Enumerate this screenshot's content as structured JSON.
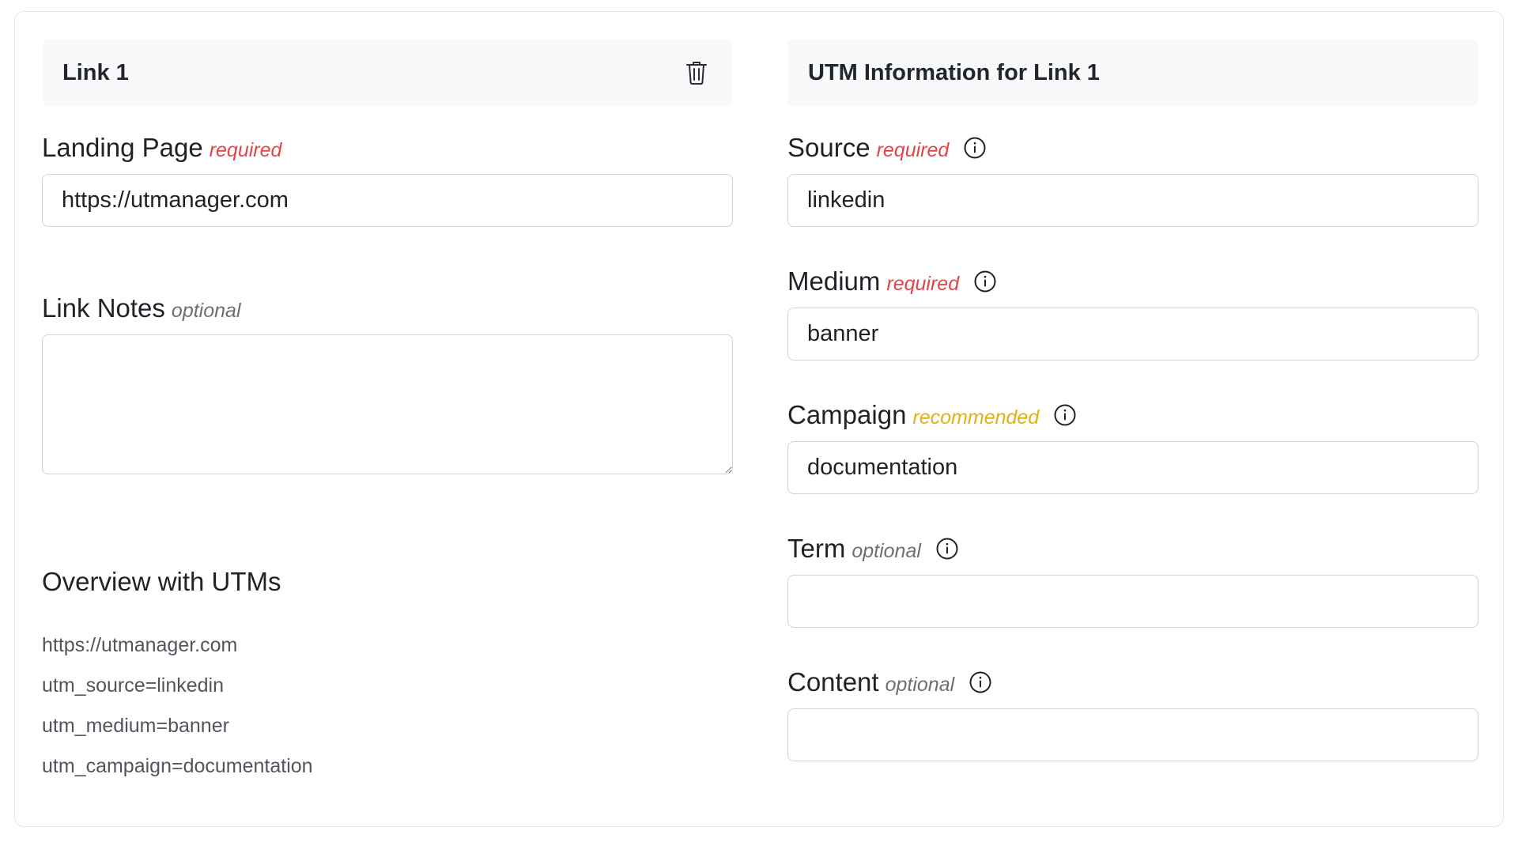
{
  "link_panel": {
    "title": "Link 1",
    "landing_page": {
      "label": "Landing Page",
      "tag": "required",
      "value": "https://utmanager.com"
    },
    "link_notes": {
      "label": "Link Notes",
      "tag": "optional",
      "value": ""
    },
    "overview": {
      "title": "Overview with UTMs",
      "lines": [
        "https://utmanager.com",
        "utm_source=linkedin",
        "utm_medium=banner",
        "utm_campaign=documentation"
      ]
    }
  },
  "utm_panel": {
    "title": "UTM Information for Link 1",
    "fields": [
      {
        "label": "Source",
        "tag": "required",
        "value": "linkedin"
      },
      {
        "label": "Medium",
        "tag": "required",
        "value": "banner"
      },
      {
        "label": "Campaign",
        "tag": "recommended",
        "value": "documentation"
      },
      {
        "label": "Term",
        "tag": "optional",
        "value": ""
      },
      {
        "label": "Content",
        "tag": "optional",
        "value": ""
      }
    ]
  },
  "colors": {
    "required": "#e0464a",
    "optional": "#6b7075",
    "recommended": "#e1b012",
    "header_bg": "#f8f9fa",
    "border": "#cfd3d8"
  },
  "icons": {
    "delete": "trash-icon",
    "info": "info-circle-icon"
  }
}
